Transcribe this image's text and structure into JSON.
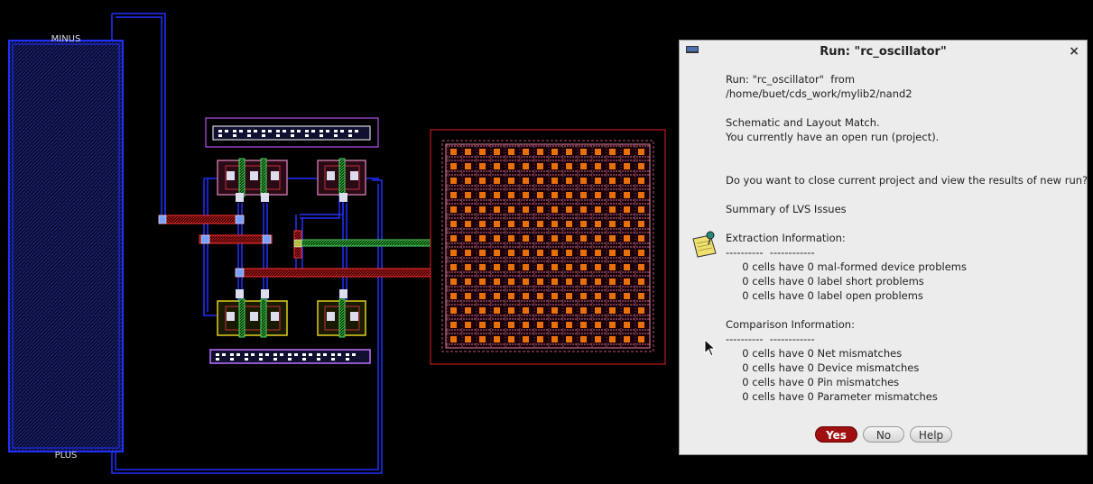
{
  "layout": {
    "pin_top": "MINUS",
    "pin_bottom": "PLUS"
  },
  "dialog": {
    "title": "Run: \"rc_oscillator\"",
    "close_glyph": "×",
    "icon": "notepad-pushpin-icon",
    "lines": [
      "Run: \"rc_oscillator\"  from",
      "/home/buet/cds_work/mylib2/nand2",
      "",
      "Schematic and Layout Match.",
      "You currently have an open run (project).",
      "",
      "",
      "Do you want to close current project and view the results of new run?",
      "",
      "Summary of LVS Issues",
      "",
      "Extraction Information:",
      "----------  ------------",
      "     0 cells have 0 mal-formed device problems",
      "     0 cells have 0 label short problems",
      "     0 cells have 0 label open problems",
      "",
      "Comparison Information:",
      "----------  ------------",
      "     0 cells have 0 Net mismatches",
      "     0 cells have 0 Device mismatches",
      "     0 cells have 0 Pin mismatches",
      "     0 cells have 0 Parameter mismatches"
    ],
    "buttons": {
      "yes": "Yes",
      "no": "No",
      "help": "Help"
    },
    "colors": {
      "yes_button": "#a01010",
      "background": "#ececec"
    }
  }
}
